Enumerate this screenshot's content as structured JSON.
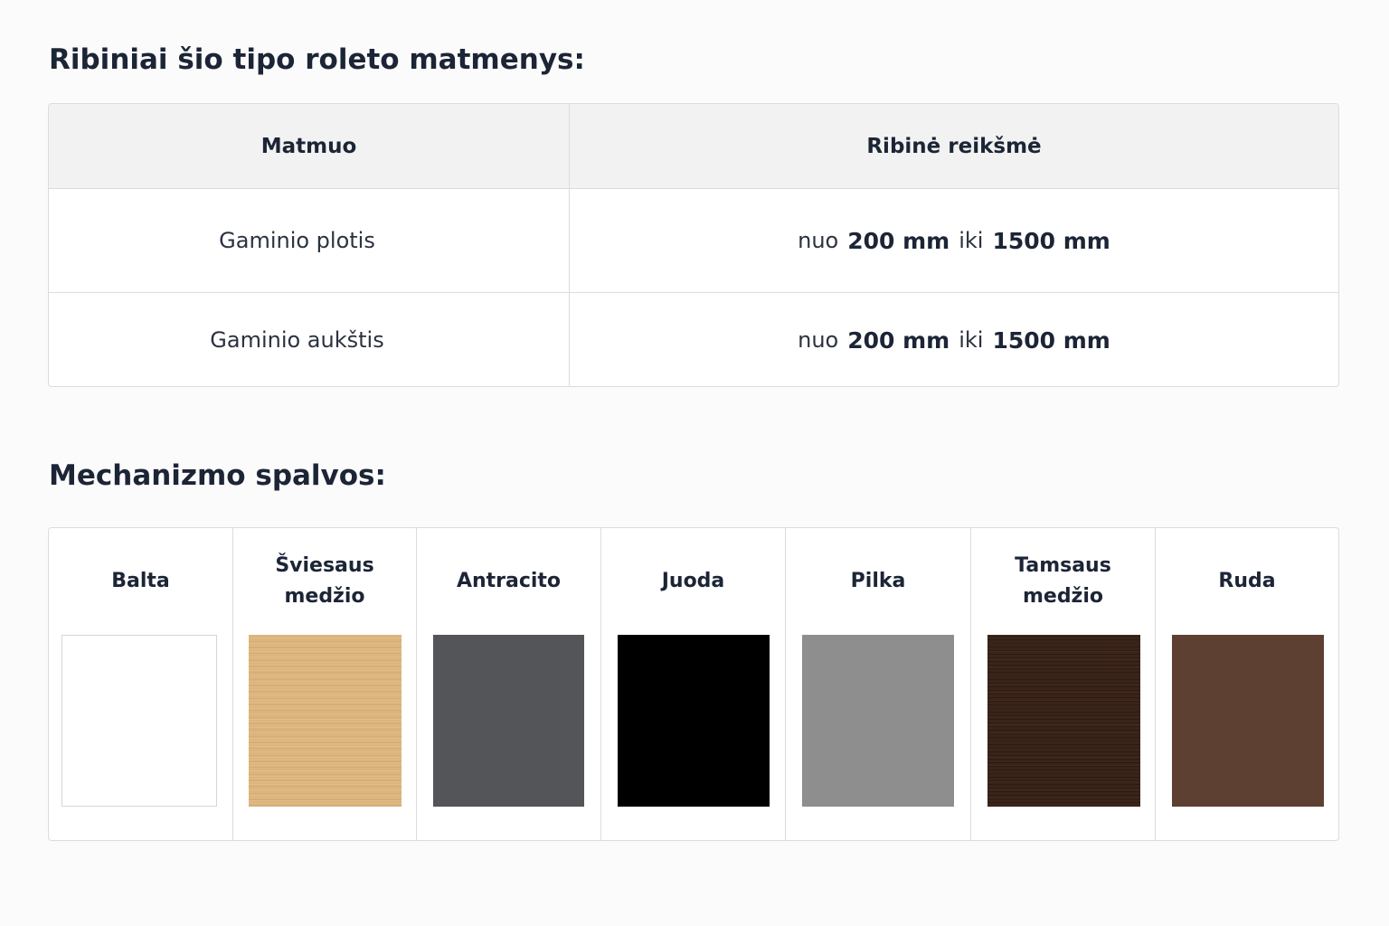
{
  "dimensions": {
    "title": "Ribiniai šio tipo roleto matmenys:",
    "header": {
      "col1": "Matmuo",
      "col2": "Ribinė reikšmė"
    },
    "rows": [
      {
        "name": "Gaminio plotis",
        "from_word": "nuo",
        "from_value": "200 mm",
        "to_word": "iki",
        "to_value": "1500 mm"
      },
      {
        "name": "Gaminio aukštis",
        "from_word": "nuo",
        "from_value": "200 mm",
        "to_word": "iki",
        "to_value": "1500 mm"
      }
    ]
  },
  "colors": {
    "title": "Mechanizmo spalvos:",
    "items": [
      {
        "label": "Balta",
        "swatch": "white",
        "hex": "#ffffff"
      },
      {
        "label": "Šviesaus medžio",
        "swatch": "light-wood",
        "hex": "#ddb47c"
      },
      {
        "label": "Antracito",
        "swatch": "anthracite",
        "hex": "#545559"
      },
      {
        "label": "Juoda",
        "swatch": "black",
        "hex": "#000000"
      },
      {
        "label": "Pilka",
        "swatch": "grey",
        "hex": "#8e8e8e"
      },
      {
        "label": "Tamsaus medžio",
        "swatch": "dark-wood",
        "hex": "#3a2419"
      },
      {
        "label": "Ruda",
        "swatch": "brown",
        "hex": "#5e4032"
      }
    ]
  }
}
